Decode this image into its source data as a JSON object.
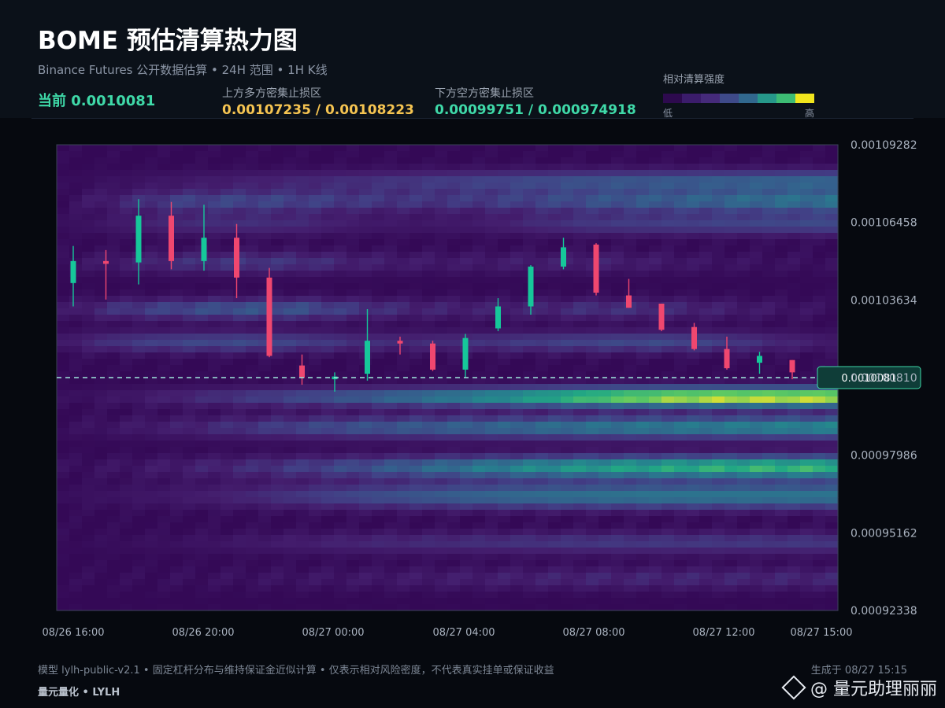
{
  "header": {
    "title": "BOME 预估清算热力图",
    "subtitle": "Binance Futures 公开数据估算 • 24H 范围 • 1H K线",
    "current_text": "当前 0.0010081",
    "upper_zone_label": "上方多方密集止损区",
    "upper_zone_value": "0.00107235 / 0.00108223",
    "lower_zone_label": "下方空方密集止损区",
    "lower_zone_value": "0.00099751 / 0.000974918"
  },
  "scale": {
    "title": "相对清算强度",
    "low": "低",
    "high": "高",
    "colors": [
      "#2d0a4e",
      "#3b1c6b",
      "#452a7a",
      "#3e4a89",
      "#31688e",
      "#26988a",
      "#3dbc74",
      "#f1e51d"
    ]
  },
  "chart_data": {
    "type": "heatmap",
    "overlay": "candlestick",
    "y_range": [
      0.00092338,
      0.00109282
    ],
    "y_ticks": [
      "0.00109282",
      "0.00106458",
      "0.00103634",
      "0.00100810",
      "0.00097986",
      "0.00095162",
      "0.00092338"
    ],
    "x_ticks": [
      "08/26 16:00",
      "08/26 20:00",
      "08/27 00:00",
      "08/27 04:00",
      "08/27 08:00",
      "08/27 12:00",
      "08/27 15:00"
    ],
    "current_price": 0.0010081,
    "current_label": "0.0010081",
    "candles": [
      {
        "o": 0.0010425,
        "h": 0.001056,
        "l": 0.001034,
        "c": 0.0010505
      },
      {
        "o": 0.0010505,
        "h": 0.0010545,
        "l": 0.0010365,
        "c": 0.0010495
      },
      {
        "o": 0.00105,
        "h": 0.001073,
        "l": 0.001042,
        "c": 0.001067
      },
      {
        "o": 0.001067,
        "h": 0.001072,
        "l": 0.0010475,
        "c": 0.0010505
      },
      {
        "o": 0.0010505,
        "h": 0.001071,
        "l": 0.001047,
        "c": 0.001059
      },
      {
        "o": 0.001059,
        "h": 0.001064,
        "l": 0.001037,
        "c": 0.0010445
      },
      {
        "o": 0.0010445,
        "h": 0.001048,
        "l": 0.0010155,
        "c": 0.001016
      },
      {
        "o": 0.0010125,
        "h": 0.0010165,
        "l": 0.0010055,
        "c": 0.001008
      },
      {
        "o": 0.0010075,
        "h": 0.00101,
        "l": 0.001003,
        "c": 0.0010085
      },
      {
        "o": 0.0010095,
        "h": 0.001033,
        "l": 0.001007,
        "c": 0.0010215
      },
      {
        "o": 0.0010215,
        "h": 0.001023,
        "l": 0.0010165,
        "c": 0.0010205
      },
      {
        "o": 0.0010205,
        "h": 0.0010215,
        "l": 0.0010105,
        "c": 0.001011
      },
      {
        "o": 0.001011,
        "h": 0.001024,
        "l": 0.001008,
        "c": 0.0010225
      },
      {
        "o": 0.001026,
        "h": 0.001037,
        "l": 0.001025,
        "c": 0.001034
      },
      {
        "o": 0.001034,
        "h": 0.001049,
        "l": 0.001031,
        "c": 0.0010485
      },
      {
        "o": 0.0010485,
        "h": 0.001059,
        "l": 0.0010475,
        "c": 0.0010555
      },
      {
        "o": 0.0010565,
        "h": 0.001057,
        "l": 0.001038,
        "c": 0.001039
      },
      {
        "o": 0.001038,
        "h": 0.001044,
        "l": 0.0010335,
        "c": 0.0010335
      },
      {
        "o": 0.001035,
        "h": 0.001035,
        "l": 0.001025,
        "c": 0.0010255
      },
      {
        "o": 0.0010265,
        "h": 0.001028,
        "l": 0.001018,
        "c": 0.0010185
      },
      {
        "o": 0.0010185,
        "h": 0.001023,
        "l": 0.001011,
        "c": 0.0010115
      },
      {
        "o": 0.0010135,
        "h": 0.0010175,
        "l": 0.0010095,
        "c": 0.001016
      },
      {
        "o": 0.0010145,
        "h": 0.0010145,
        "l": 0.0010075,
        "c": 0.00101
      }
    ],
    "bands": [
      {
        "y": 0.0010795,
        "w": 3e-06,
        "a": [
          0.02,
          0.06,
          0.1,
          0.14,
          0.18,
          0.22,
          0.26,
          0.3,
          0.34,
          0.38,
          0.4,
          0.42,
          0.44,
          0.46
        ]
      },
      {
        "y": 0.0010722,
        "w": 2.8e-06,
        "a": [
          0.04,
          0.18,
          0.3,
          0.32,
          0.3,
          0.26,
          0.24,
          0.26,
          0.3,
          0.36,
          0.4,
          0.44,
          0.48,
          0.5
        ]
      },
      {
        "y": 0.001064,
        "w": 3e-06,
        "a": [
          0.04,
          0.12,
          0.2,
          0.22,
          0.2,
          0.12,
          0.1,
          0.12,
          0.2,
          0.26,
          0.28,
          0.3,
          0.32,
          0.34
        ]
      },
      {
        "y": 0.00105,
        "w": 3e-06,
        "a": [
          0.06,
          0.14,
          0.22,
          0.26,
          0.24,
          0.16,
          0.12,
          0.12,
          0.14,
          0.16,
          0.12,
          0.08,
          0.06,
          0.05
        ]
      },
      {
        "y": 0.001033,
        "w": 2.8e-06,
        "a": [
          0.1,
          0.26,
          0.34,
          0.4,
          0.38,
          0.26,
          0.18,
          0.16,
          0.18,
          0.24,
          0.22,
          0.16,
          0.1,
          0.06
        ]
      },
      {
        "y": 0.001021,
        "w": 2.8e-06,
        "a": [
          0.12,
          0.26,
          0.32,
          0.34,
          0.3,
          0.22,
          0.2,
          0.24,
          0.28,
          0.32,
          0.34,
          0.3,
          0.2,
          0.12
        ]
      },
      {
        "y": 0.001001,
        "w": 2.6e-06,
        "a": [
          0.04,
          0.1,
          0.18,
          0.26,
          0.34,
          0.42,
          0.52,
          0.62,
          0.74,
          0.88,
          0.96,
          1.0,
          1.0,
          1.0
        ]
      },
      {
        "y": 0.00099,
        "w": 3e-06,
        "a": [
          0.04,
          0.1,
          0.16,
          0.24,
          0.32,
          0.38,
          0.42,
          0.46,
          0.5,
          0.54,
          0.56,
          0.58,
          0.6,
          0.62
        ]
      },
      {
        "y": 0.0009755,
        "w": 3e-06,
        "a": [
          0.04,
          0.08,
          0.14,
          0.2,
          0.28,
          0.36,
          0.46,
          0.56,
          0.64,
          0.7,
          0.74,
          0.78,
          0.8,
          0.8
        ]
      },
      {
        "y": 0.000965,
        "w": 3.4e-06,
        "a": [
          0.04,
          0.08,
          0.12,
          0.18,
          0.26,
          0.34,
          0.4,
          0.46,
          0.5,
          0.52,
          0.54,
          0.54,
          0.54,
          0.54
        ]
      },
      {
        "y": 0.000948,
        "w": 3e-06,
        "a": [
          0.02,
          0.04,
          0.06,
          0.1,
          0.14,
          0.18,
          0.2,
          0.22,
          0.24,
          0.26,
          0.26,
          0.26,
          0.26,
          0.26
        ]
      },
      {
        "y": 0.000935,
        "w": 3e-06,
        "a": [
          0.02,
          0.02,
          0.04,
          0.06,
          0.08,
          0.1,
          0.12,
          0.14,
          0.16,
          0.18,
          0.18,
          0.18,
          0.18,
          0.18
        ]
      }
    ]
  },
  "footer": {
    "note": "模型 lylh-public-v2.1 • 固定杠杆分布与维持保证金近似计算 • 仅表示相对风险密度，不代表真实挂单或保证收益",
    "generated": "生成于 08/27 15:15",
    "brand": "量元量化 • LYLH",
    "watermark": "@ 量元助理丽丽"
  }
}
